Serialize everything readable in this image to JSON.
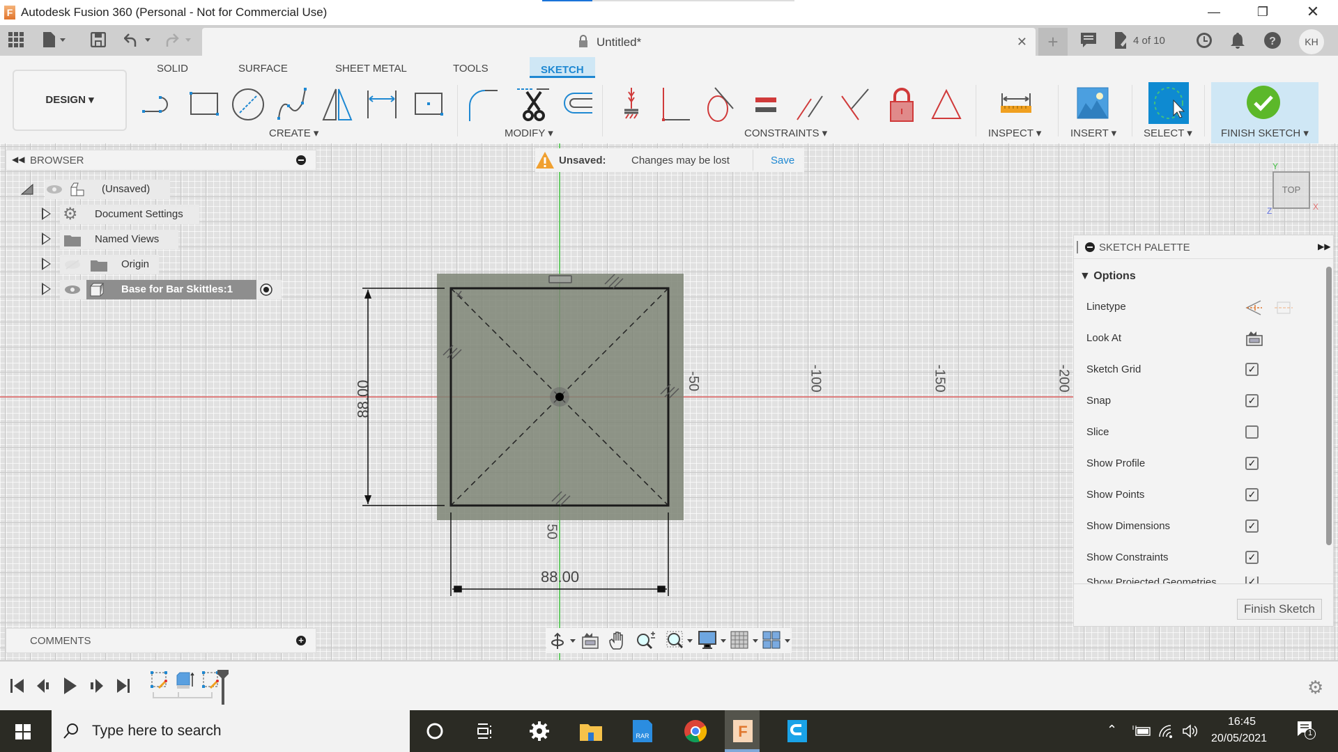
{
  "window": {
    "title": "Autodesk Fusion 360 (Personal - Not for Commercial Use)",
    "controls": [
      "minimize",
      "restore",
      "close"
    ]
  },
  "quick_access": {
    "icons": [
      "grid-apps-icon",
      "file-icon",
      "save-icon",
      "undo-icon",
      "redo-icon"
    ]
  },
  "document_tab": {
    "name": "Untitled*",
    "locked": true
  },
  "header_right": {
    "job_status": "4 of 10",
    "avatar": "KH"
  },
  "ribbon": {
    "workspace": "DESIGN",
    "tabs": [
      {
        "label": "SOLID",
        "active": false
      },
      {
        "label": "SURFACE",
        "active": false
      },
      {
        "label": "SHEET METAL",
        "active": false
      },
      {
        "label": "TOOLS",
        "active": false
      },
      {
        "label": "SKETCH",
        "active": true
      }
    ],
    "groups": {
      "create": "CREATE",
      "modify": "MODIFY",
      "constraints": "CONSTRAINTS",
      "inspect": "INSPECT",
      "insert": "INSERT",
      "select": "SELECT",
      "finish": "FINISH SKETCH"
    },
    "create_tools": [
      "line",
      "rectangle",
      "circle",
      "spline",
      "mirror",
      "dimension",
      "point"
    ],
    "modify_tools": [
      "fillet",
      "trim",
      "offset"
    ],
    "constraint_tools": [
      "fix",
      "coincident",
      "tangent",
      "equal",
      "parallel",
      "perpendicular",
      "lock",
      "triangle"
    ]
  },
  "browser": {
    "title": "BROWSER",
    "items": [
      {
        "label": "(Unsaved)",
        "level": 0
      },
      {
        "label": "Document Settings",
        "level": 1
      },
      {
        "label": "Named Views",
        "level": 1
      },
      {
        "label": "Origin",
        "level": 1
      },
      {
        "label": "Base for Bar Skittles:1",
        "level": 1,
        "selected": true
      }
    ]
  },
  "notification": {
    "status": "Unsaved:",
    "message": "Changes may be lost",
    "action": "Save"
  },
  "viewcube": {
    "face": "TOP",
    "axes": {
      "y": "Y",
      "x": "X",
      "z": "Z"
    }
  },
  "sketch": {
    "width_dimension": "88.00",
    "height_dimension": "88.00",
    "axis_labels": {
      "vertical_50": "50",
      "horizontal": [
        "-50",
        "-100",
        "-150",
        "-200"
      ]
    }
  },
  "sketch_palette": {
    "title": "SKETCH PALETTE",
    "section": "Options",
    "rows": [
      {
        "label": "Linetype",
        "type": "icons"
      },
      {
        "label": "Look At",
        "type": "icon"
      },
      {
        "label": "Sketch Grid",
        "type": "checkbox",
        "checked": true
      },
      {
        "label": "Snap",
        "type": "checkbox",
        "checked": true
      },
      {
        "label": "Slice",
        "type": "checkbox",
        "checked": false
      },
      {
        "label": "Show Profile",
        "type": "checkbox",
        "checked": true
      },
      {
        "label": "Show Points",
        "type": "checkbox",
        "checked": true
      },
      {
        "label": "Show Dimensions",
        "type": "checkbox",
        "checked": true
      },
      {
        "label": "Show Constraints",
        "type": "checkbox",
        "checked": true
      },
      {
        "label": "Show Projected Geometries",
        "type": "checkbox",
        "checked": true
      }
    ],
    "finish_button": "Finish Sketch"
  },
  "comments": {
    "title": "COMMENTS"
  },
  "taskbar": {
    "search_placeholder": "Type here to search",
    "time": "16:45",
    "date": "20/05/2021",
    "notifications_count": "1"
  },
  "colors": {
    "accent": "#1e88d2",
    "finish_green": "#5cb82a",
    "constraint_red": "#d03a3a",
    "x_axis": "#e06060",
    "y_axis": "#40c040"
  }
}
